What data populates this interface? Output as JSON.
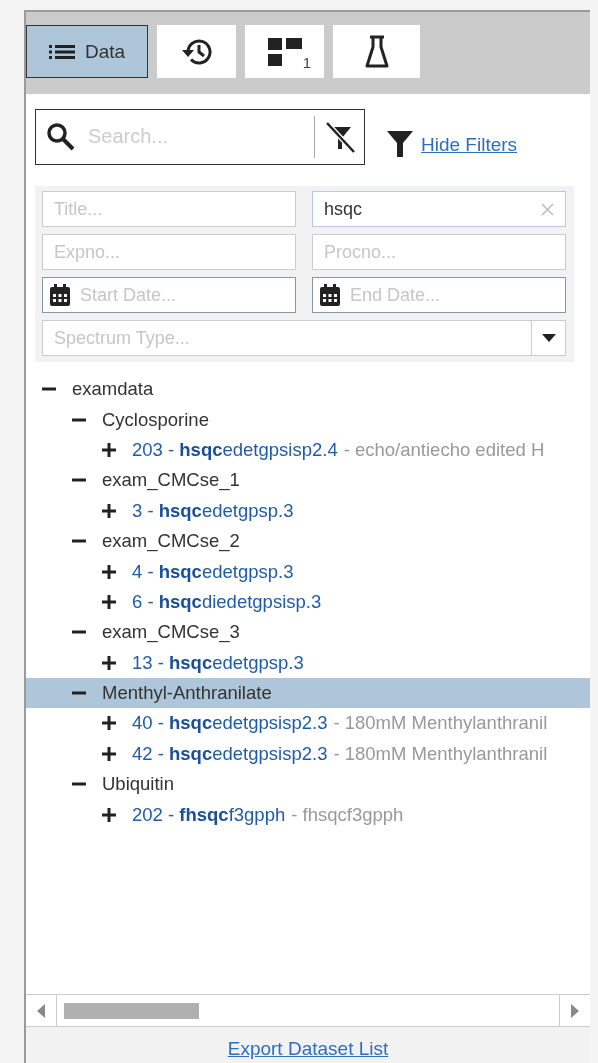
{
  "tabs": [
    {
      "kind": "list",
      "label": "Data",
      "selected": true
    },
    {
      "kind": "history",
      "selected": false
    },
    {
      "kind": "grid",
      "badge": "1",
      "selected": false
    },
    {
      "kind": "flask",
      "selected": false
    }
  ],
  "search": {
    "placeholder": "Search..."
  },
  "filter_toggle": {
    "label": "Hide Filters"
  },
  "filters": {
    "title": {
      "placeholder": "Title..."
    },
    "pulse_program": {
      "value": "hsqc"
    },
    "expno": {
      "placeholder": "Expno..."
    },
    "procno": {
      "placeholder": "Procno..."
    },
    "start_date": {
      "placeholder": "Start Date..."
    },
    "end_date": {
      "placeholder": "End Date..."
    },
    "spectrum_type": {
      "placeholder": "Spectrum Type..."
    }
  },
  "tree": [
    {
      "label": "examdata",
      "expanded": true,
      "selected": false,
      "children": [
        {
          "label": "Cyclosporine",
          "expanded": true,
          "selected": false,
          "children": [
            {
              "kind": "dataset",
              "label": "203 - **hsqc**edetgpsisp2.4",
              "description": "- echo/antiecho edited H",
              "expanded": false,
              "selected": false
            }
          ]
        },
        {
          "label": "exam_CMCse_1",
          "expanded": true,
          "selected": false,
          "children": [
            {
              "kind": "dataset",
              "label": "3 - **hsqc**edetgpsp.3",
              "expanded": false,
              "selected": false
            }
          ]
        },
        {
          "label": "exam_CMCse_2",
          "expanded": true,
          "selected": false,
          "children": [
            {
              "kind": "dataset",
              "label": "4 - **hsqc**edetgpsp.3",
              "expanded": false,
              "selected": false
            },
            {
              "kind": "dataset",
              "label": "6 - **hsqc**diedetgpsisp.3",
              "expanded": false,
              "selected": false
            }
          ]
        },
        {
          "label": "exam_CMCse_3",
          "expanded": true,
          "selected": false,
          "children": [
            {
              "kind": "dataset",
              "label": "13 - **hsqc**edetgpsp.3",
              "expanded": false,
              "selected": false
            }
          ]
        },
        {
          "label": "Menthyl-Anthranilate",
          "expanded": true,
          "selected": true,
          "children": [
            {
              "kind": "dataset",
              "label": "40 - **hsqc**edetgpsisp2.3",
              "description": "- 180mM Menthylanthranil",
              "expanded": false,
              "selected": false
            },
            {
              "kind": "dataset",
              "label": "42 - **hsqc**edetgpsisp2.3",
              "description": "- 180mM Menthylanthranil",
              "expanded": false,
              "selected": false
            }
          ]
        },
        {
          "label": "Ubiquitin",
          "expanded": true,
          "selected": false,
          "children": [
            {
              "kind": "dataset",
              "label": "202 - **fhsqc**f3gpph",
              "description": "- fhsqcf3gpph",
              "expanded": false,
              "selected": false
            }
          ]
        }
      ]
    }
  ],
  "footer": {
    "link": "Export Dataset List"
  }
}
